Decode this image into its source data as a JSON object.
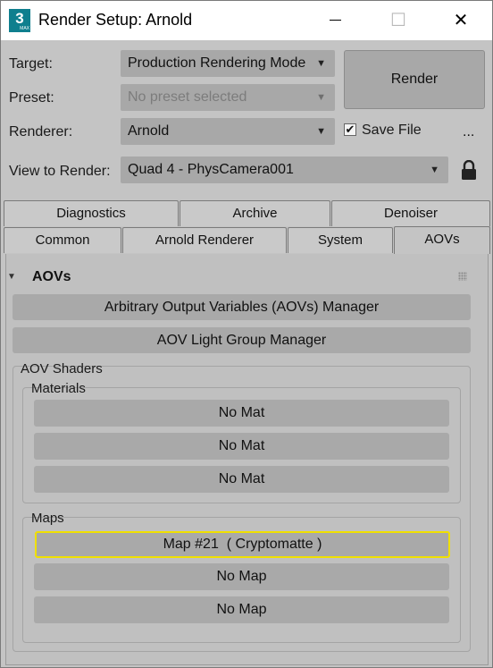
{
  "window": {
    "title": "Render Setup: Arnold",
    "app_icon_text": "3",
    "app_icon_sub": "MAX",
    "controls": {
      "minimize_icon": "minimize-icon",
      "maximize_icon": "maximize-icon",
      "close_icon": "close-icon"
    }
  },
  "settings": {
    "target_label": "Target:",
    "target_value": "Production Rendering Mode",
    "preset_label": "Preset:",
    "preset_placeholder": "No preset selected",
    "renderer_label": "Renderer:",
    "renderer_value": "Arnold",
    "save_file_label": "Save File",
    "save_file_checked": true,
    "more_label": "...",
    "view_label": "View to Render:",
    "view_value": "Quad 4 - PhysCamera001",
    "render_button": "Render"
  },
  "tabs_row1": [
    "Diagnostics",
    "Archive",
    "Denoiser"
  ],
  "tabs_row2": [
    "Common",
    "Arnold Renderer",
    "System",
    "AOVs"
  ],
  "active_tab": "AOVs",
  "rollout": {
    "title": "AOVs",
    "manager_button": "Arbitrary Output Variables (AOVs) Manager",
    "light_group_button": "AOV Light Group Manager",
    "shaders_label": "AOV Shaders",
    "materials_label": "Materials",
    "materials": [
      "No Mat",
      "No Mat",
      "No Mat"
    ],
    "maps_label": "Maps",
    "maps": [
      "Map #21  ( Cryptomatte )",
      "No Map",
      "No Map"
    ]
  },
  "colors": {
    "highlight": "#f0e000",
    "app_icon": "#0f7f8e",
    "panel": "#c4c4c4",
    "button": "#a9a9a9"
  }
}
